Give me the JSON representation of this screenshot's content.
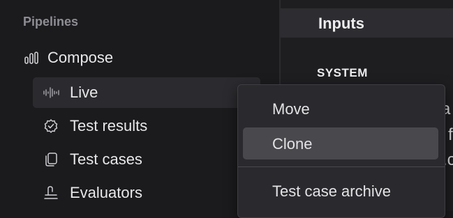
{
  "sidebar": {
    "section_title": "Pipelines",
    "compose": {
      "label": "Compose",
      "icon": "bar-chart-icon"
    },
    "items": [
      {
        "label": "Live",
        "icon": "waveform-icon",
        "active": true
      },
      {
        "label": "Test results",
        "icon": "check-badge-icon"
      },
      {
        "label": "Test cases",
        "icon": "copy-icon"
      },
      {
        "label": "Evaluators",
        "icon": "scale-icon"
      }
    ]
  },
  "panel": {
    "title": "Inputs",
    "section_label": "SYSTEM",
    "peek_text": [
      "e a",
      "f",
      ".c"
    ]
  },
  "context_menu": {
    "items": [
      {
        "label": "Move"
      },
      {
        "label": "Clone",
        "highlighted": true
      },
      {
        "label": "Test case archive"
      }
    ]
  },
  "colors": {
    "background": "#1b1b1e",
    "active_row": "#2b2b2f",
    "menu_bg": "#2a2a2e",
    "menu_highlight": "#48484d"
  }
}
